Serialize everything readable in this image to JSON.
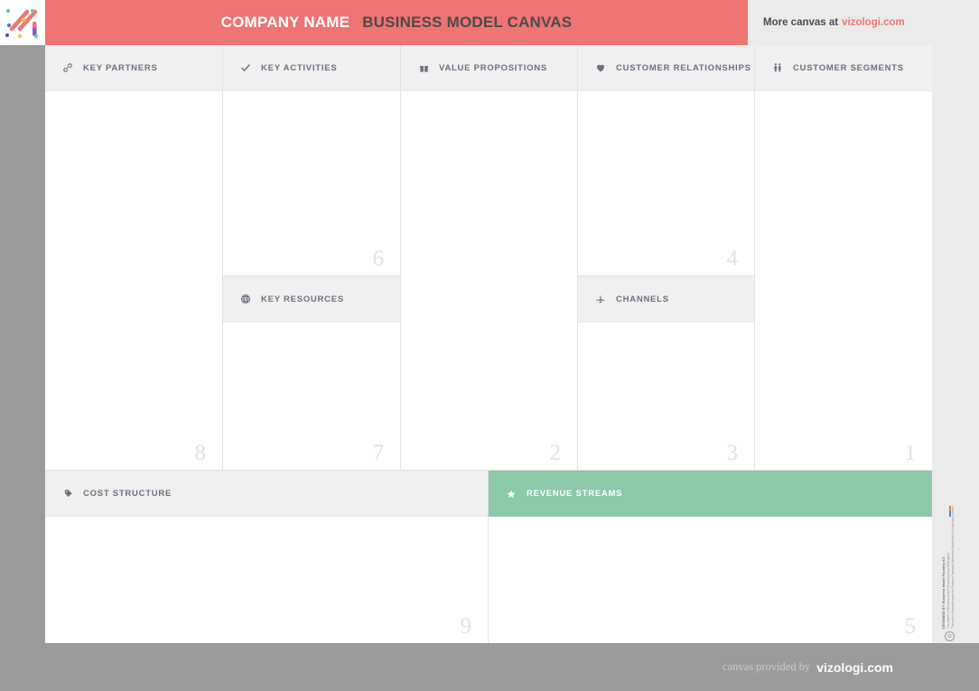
{
  "header": {
    "company_name": "COMPANY NAME",
    "title": "BUSINESS MODEL CANVAS",
    "more_canvas_label": "More canvas at",
    "more_canvas_link": "vizologi.com",
    "logo_icon": "vizologi-logo-icon"
  },
  "colors": {
    "header_bar": "#ef7572",
    "revenue_green": "#8bc9a9",
    "page_background": "#9b9b9b",
    "cell_header": "#f0f0f0",
    "cell_number": "#e2e2e2",
    "title_text": "#4a4a4a",
    "link": "#ef7572"
  },
  "blocks": {
    "key_partners": {
      "label": "KEY PARTNERS",
      "number": "8",
      "icon": "link-icon"
    },
    "key_activities": {
      "label": "KEY ACTIVITIES",
      "number": "6",
      "icon": "check-icon"
    },
    "key_resources": {
      "label": "KEY RESOURCES",
      "number": "7",
      "icon": "globe-icon"
    },
    "value_propositions": {
      "label": "VALUE PROPOSITIONS",
      "number": "2",
      "icon": "gift-icon"
    },
    "customer_relationships": {
      "label": "CUSTOMER RELATIONSHIPS",
      "number": "4",
      "icon": "heart-icon"
    },
    "channels": {
      "label": "CHANNELS",
      "number": "3",
      "icon": "airplane-icon"
    },
    "customer_segments": {
      "label": "CUSTOMER SEGMENTS",
      "number": "1",
      "icon": "people-icon"
    },
    "cost_structure": {
      "label": "COST STRUCTURE",
      "number": "9",
      "icon": "tag-icon"
    },
    "revenue_streams": {
      "label": "REVENUE STREAMS",
      "number": "5",
      "icon": "star-icon"
    }
  },
  "attribution": {
    "line1": "DESIGNED BY: Business Model Foundry AG",
    "line2": "The makers of Business Model Generation and Strategyzer",
    "line3": "This work is licensed under the Creative Commons Attribution-Share Alike 3.0 Unported License.",
    "badges": [
      "cc-icon",
      "by-icon",
      "at-icon",
      "sa-icon",
      "r-icon"
    ]
  },
  "footer": {
    "provided_by": "canvas provided by",
    "brand": "vizologi.com"
  }
}
